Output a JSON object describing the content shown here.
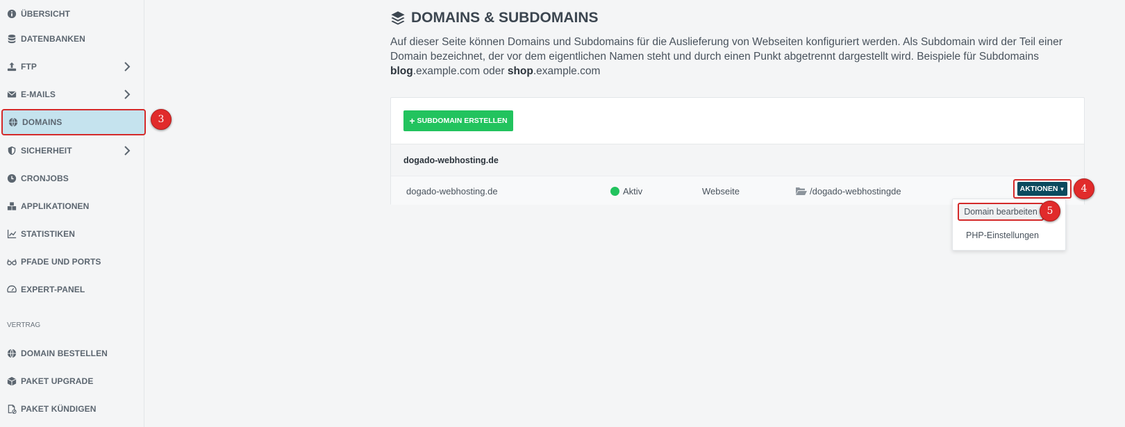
{
  "sidebar": {
    "items": [
      {
        "label": "ÜBERSICHT",
        "icon": "info-circle-icon"
      },
      {
        "label": "DATENBANKEN",
        "icon": "database-icon"
      },
      {
        "label": "FTP",
        "icon": "upload-icon",
        "has_submenu": true
      },
      {
        "label": "E-MAILS",
        "icon": "envelope-icon",
        "has_submenu": true
      },
      {
        "label": "DOMAINS",
        "icon": "globe-icon",
        "active": true
      },
      {
        "label": "SICHERHEIT",
        "icon": "shield-icon",
        "has_submenu": true
      },
      {
        "label": "CRONJOBS",
        "icon": "clock-icon"
      },
      {
        "label": "APPLIKATIONEN",
        "icon": "cubes-icon"
      },
      {
        "label": "STATISTIKEN",
        "icon": "chart-line-icon"
      },
      {
        "label": "PFADE UND PORTS",
        "icon": "glasses-icon"
      },
      {
        "label": "EXPERT-PANEL",
        "icon": "gauge-icon"
      }
    ],
    "section_label": "VERTRAG",
    "contract_items": [
      {
        "label": "DOMAIN BESTELLEN",
        "icon": "globe-icon"
      },
      {
        "label": "PAKET UPGRADE",
        "icon": "box-icon"
      },
      {
        "label": "PAKET KÜNDIGEN",
        "icon": "file-cancel-icon"
      }
    ]
  },
  "callouts": {
    "domains": "3",
    "actions": "4",
    "edit": "5"
  },
  "main": {
    "title": "DOMAINS & SUBDOMAINS",
    "description_parts": {
      "intro": "Auf dieser Seite können Domains und Subdomains für die Auslieferung von Webseiten konfiguriert werden. Als Subdomain wird der Teil einer Domain bezeichnet, der vor dem eigentlichen Namen steht und durch einen Punkt abgetrennt dargestellt wird. Beispiele für Subdomains ",
      "ex1_bold": "blog",
      "ex1_rest": ".example.com oder ",
      "ex2_bold": "shop",
      "ex2_rest": ".example.com"
    },
    "create_button": "SUBDOMAIN ERSTELLEN",
    "group_name": "dogado-webhosting.de",
    "row": {
      "domain": "dogado-webhosting.de",
      "status": "Aktiv",
      "type": "Webseite",
      "path": "/dogado-webhostingde"
    },
    "actions_button": "AKTIONEN",
    "dropdown": [
      "Domain bearbeiten",
      "PHP-Einstellungen"
    ]
  },
  "colors": {
    "accent_green": "#22c35e",
    "actions_button": "#0b4a5e",
    "highlight_red": "#d42a2a",
    "active_nav_bg": "#c5e3ee"
  }
}
